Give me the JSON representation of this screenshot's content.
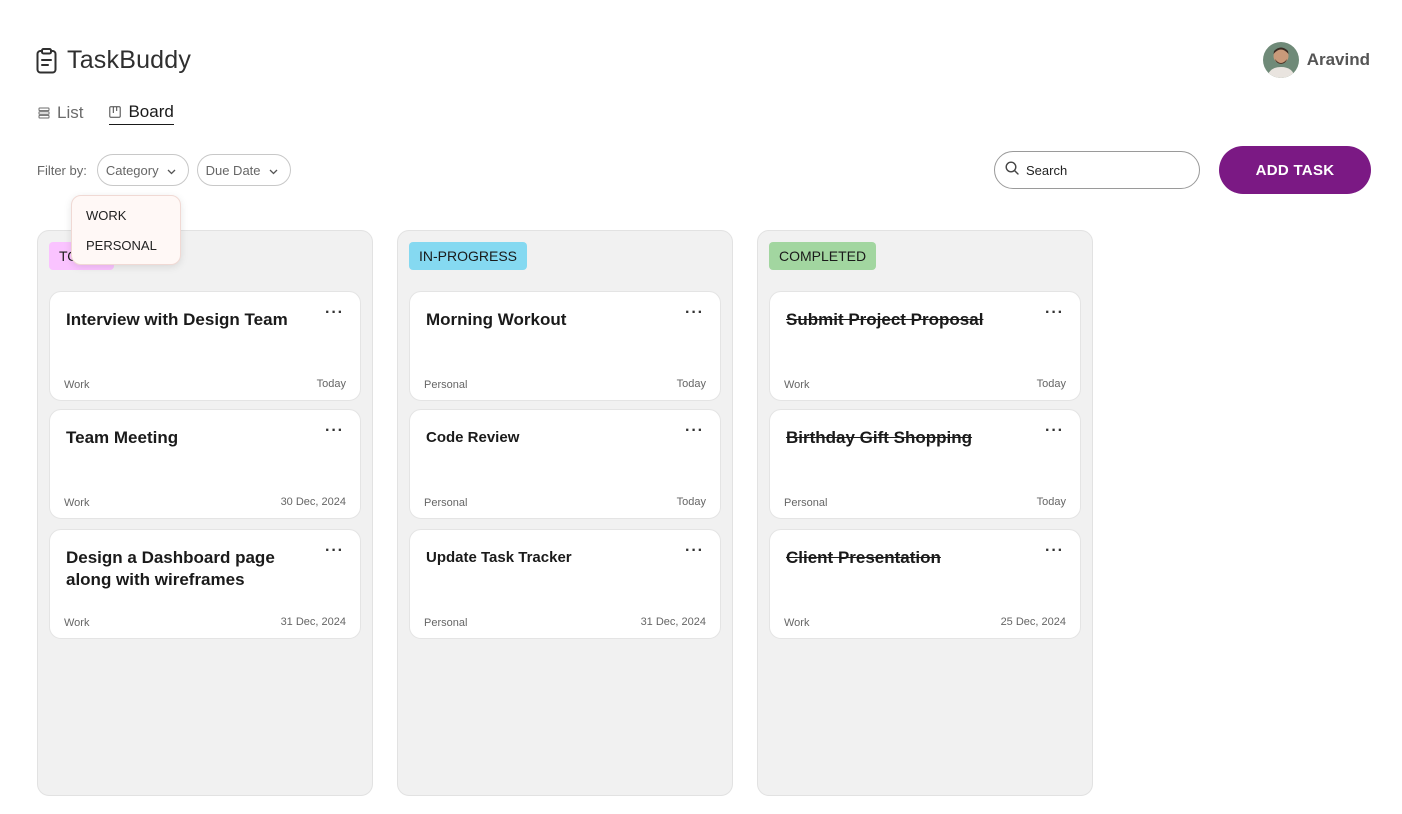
{
  "app": {
    "title": "TaskBuddy"
  },
  "user": {
    "name": "Aravind"
  },
  "views": [
    {
      "label": "List",
      "active": false
    },
    {
      "label": "Board",
      "active": true
    }
  ],
  "filters": {
    "label": "Filter by:",
    "category": "Category",
    "due_date": "Due Date",
    "category_options": [
      "WORK",
      "PERSONAL"
    ]
  },
  "search": {
    "placeholder": "Search"
  },
  "add_task": {
    "label": "ADD TASK"
  },
  "colors": {
    "accent": "#7b1984",
    "todo": "#fac3ff",
    "in_progress": "#85d9f1",
    "completed": "#a2d6a0"
  },
  "columns": [
    {
      "title": "TO-DO",
      "tasks": [
        {
          "title": "Interview with Design Team",
          "category": "Work",
          "due": "Today"
        },
        {
          "title": "Team Meeting",
          "category": "Work",
          "due": "30 Dec, 2024"
        },
        {
          "title": "Design a Dashboard page along with wireframes",
          "category": "Work",
          "due": "31 Dec, 2024"
        }
      ]
    },
    {
      "title": "IN-PROGRESS",
      "tasks": [
        {
          "title": "Morning Workout",
          "category": "Personal",
          "due": "Today"
        },
        {
          "title": "Code Review",
          "category": "Personal",
          "due": "Today"
        },
        {
          "title": "Update Task Tracker",
          "category": "Personal",
          "due": "31 Dec, 2024"
        }
      ]
    },
    {
      "title": "COMPLETED",
      "tasks": [
        {
          "title": "Submit Project Proposal",
          "category": "Work",
          "due": "Today"
        },
        {
          "title": "Birthday Gift Shopping",
          "category": "Personal",
          "due": "Today"
        },
        {
          "title": "Client Presentation",
          "category": "Work",
          "due": "25 Dec, 2024"
        }
      ]
    }
  ]
}
